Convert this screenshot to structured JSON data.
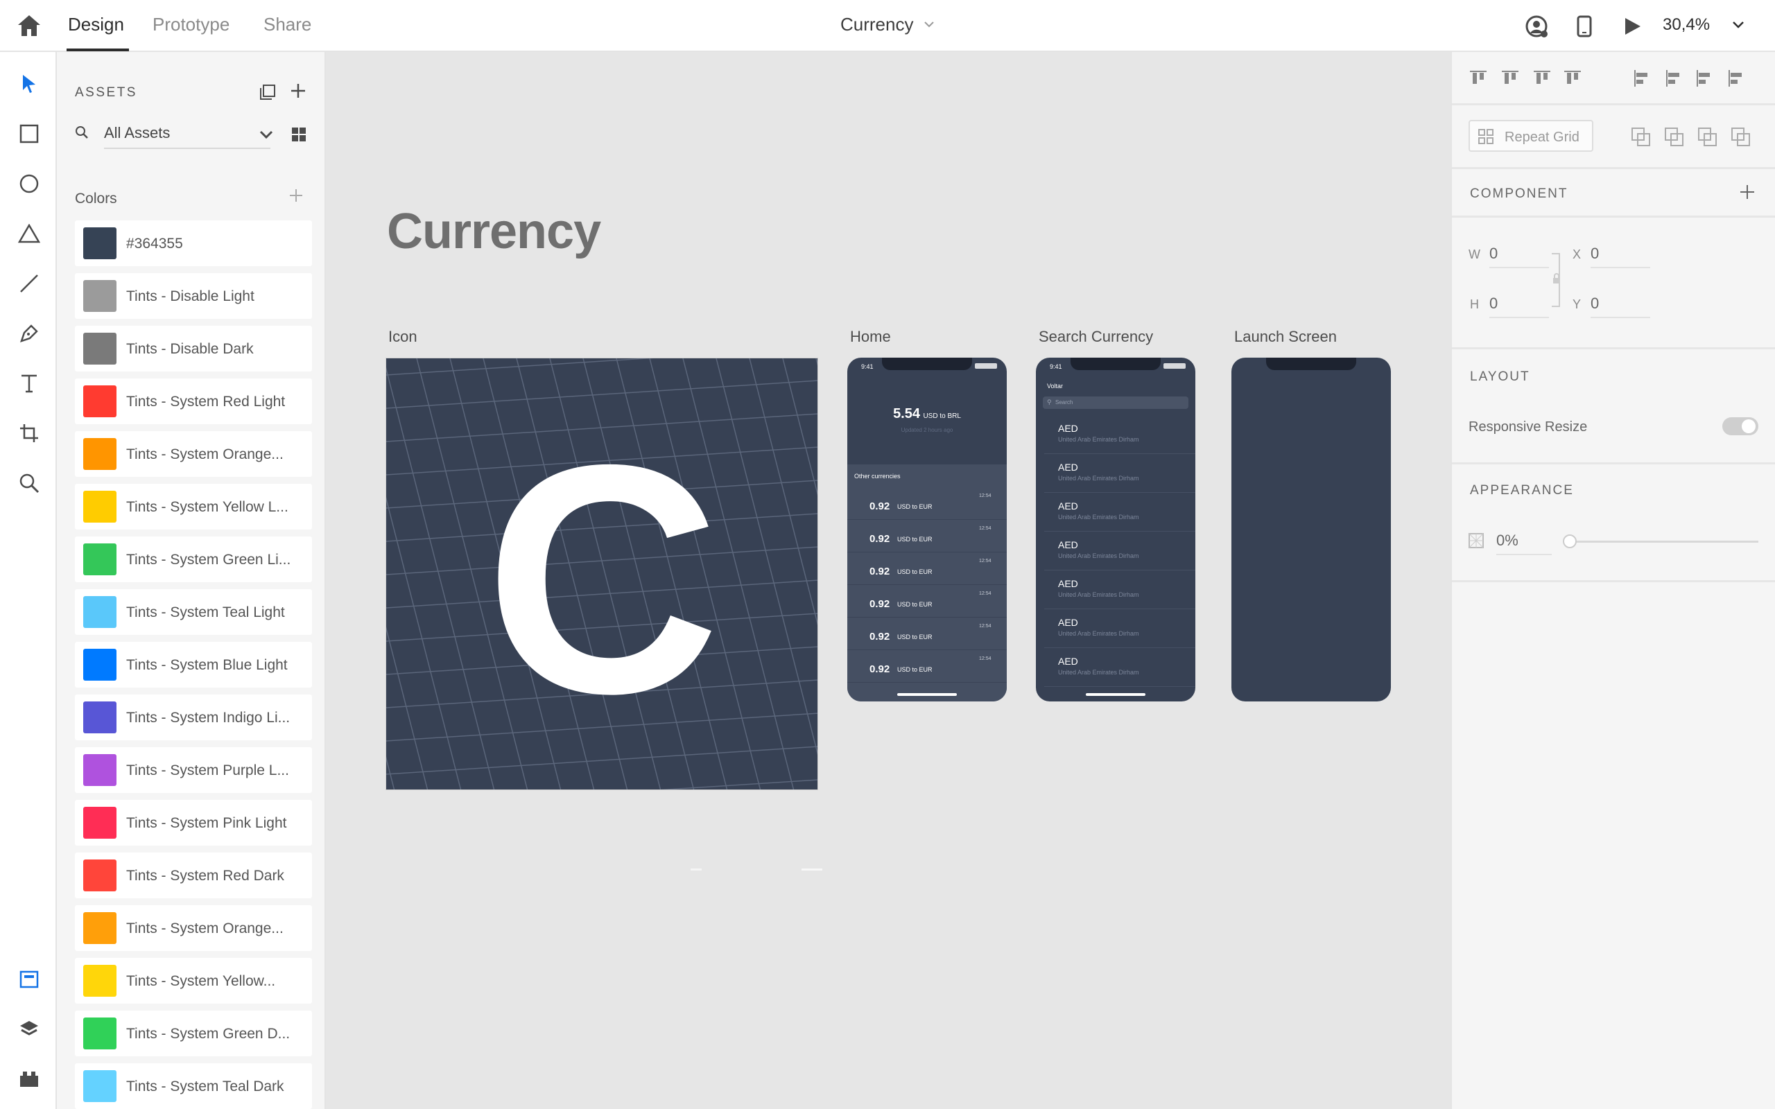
{
  "topbar": {
    "tabs": [
      {
        "label": "Design"
      },
      {
        "label": "Prototype"
      },
      {
        "label": "Share"
      }
    ],
    "title": "Currency",
    "zoom": "30,4%"
  },
  "assets": {
    "heading": "ASSETS",
    "filter": "All Assets",
    "colors_heading": "Colors",
    "colors": [
      {
        "label": "#364355",
        "color": "#364355"
      },
      {
        "label": "Tints - Disable Light",
        "color": "#9b9b9b"
      },
      {
        "label": "Tints - Disable Dark",
        "color": "#7a7a7a"
      },
      {
        "label": "Tints - System Red Light",
        "color": "#ff3b30"
      },
      {
        "label": "Tints - System Orange...",
        "color": "#ff9500"
      },
      {
        "label": "Tints - System Yellow L...",
        "color": "#ffcc00"
      },
      {
        "label": "Tints - System Green Li...",
        "color": "#34c759"
      },
      {
        "label": "Tints - System Teal Light",
        "color": "#5ac8fa"
      },
      {
        "label": "Tints - System Blue Light",
        "color": "#007aff"
      },
      {
        "label": "Tints - System Indigo Li...",
        "color": "#5856d6"
      },
      {
        "label": "Tints - System Purple L...",
        "color": "#af52de"
      },
      {
        "label": "Tints - System Pink Light",
        "color": "#ff2d55"
      },
      {
        "label": "Tints - System Red Dark",
        "color": "#ff453a"
      },
      {
        "label": "Tints - System Orange...",
        "color": "#ff9f0a"
      },
      {
        "label": "Tints - System Yellow...",
        "color": "#ffd60a"
      },
      {
        "label": "Tints - System Green D...",
        "color": "#30d158"
      },
      {
        "label": "Tints - System Teal Dark",
        "color": "#64d2ff"
      }
    ]
  },
  "canvas": {
    "page_title": "Currency",
    "artboards": {
      "icon": {
        "label": "Icon",
        "letter": "C"
      },
      "home": {
        "label": "Home",
        "time": "9:41",
        "rate": "5.54",
        "rate_unit": "USD to BRL",
        "updated": "Updated 2 hours ago",
        "section": "Other currencies",
        "rows": [
          {
            "value": "0.92",
            "unit": "USD to EUR",
            "time": "12:54"
          },
          {
            "value": "0.92",
            "unit": "USD to EUR",
            "time": "12:54"
          },
          {
            "value": "0.92",
            "unit": "USD to EUR",
            "time": "12:54"
          },
          {
            "value": "0.92",
            "unit": "USD to EUR",
            "time": "12:54"
          },
          {
            "value": "0.92",
            "unit": "USD to EUR",
            "time": "12:54"
          },
          {
            "value": "0.92",
            "unit": "USD to EUR",
            "time": "12:54"
          }
        ]
      },
      "search": {
        "label": "Search Currency",
        "time": "9:41",
        "back": "Voltar",
        "placeholder": "Search",
        "rows": [
          {
            "code": "AED",
            "name": "United Arab Emirates Dirham"
          },
          {
            "code": "AED",
            "name": "United Arab Emirates Dirham"
          },
          {
            "code": "AED",
            "name": "United Arab Emirates Dirham"
          },
          {
            "code": "AED",
            "name": "United Arab Emirates Dirham"
          },
          {
            "code": "AED",
            "name": "United Arab Emirates Dirham"
          },
          {
            "code": "AED",
            "name": "United Arab Emirates Dirham"
          },
          {
            "code": "AED",
            "name": "United Arab Emirates Dirham"
          }
        ]
      },
      "launch": {
        "label": "Launch Screen"
      }
    }
  },
  "props": {
    "repeat_grid": "Repeat Grid",
    "component": "COMPONENT",
    "w_label": "W",
    "w": "0",
    "x_label": "X",
    "x": "0",
    "h_label": "H",
    "h": "0",
    "y_label": "Y",
    "y": "0",
    "layout": "LAYOUT",
    "responsive": "Responsive Resize",
    "appearance": "APPEARANCE",
    "opacity": "0%"
  },
  "colors": {
    "accent": "#1473e6",
    "artboard": "#374154"
  }
}
